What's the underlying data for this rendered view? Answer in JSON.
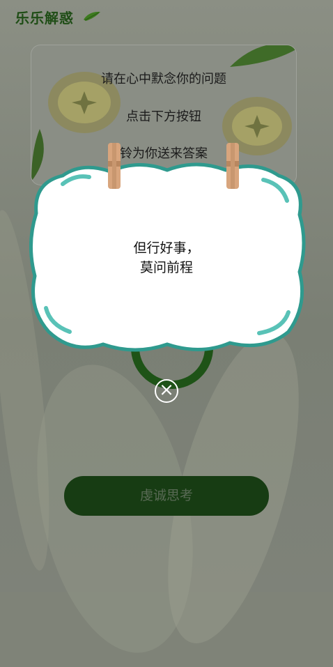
{
  "app": {
    "title": "乐乐解惑"
  },
  "card": {
    "lines": [
      "请在心中默念你的问题",
      "点击下方按钮",
      "铃为你送来答案"
    ]
  },
  "popup": {
    "answer_line1": "但行好事，",
    "answer_line2": "莫问前程"
  },
  "actions": {
    "main_button": "虔诚思考",
    "close_symbol": "×"
  },
  "colors": {
    "dark_green": "#173c13",
    "cloud_border": "#3aa59a",
    "card_overlay": "#8a8e85"
  },
  "icons": {
    "title_decoration": "leaf-icon",
    "close": "close-icon",
    "clip": "clip-icon"
  }
}
